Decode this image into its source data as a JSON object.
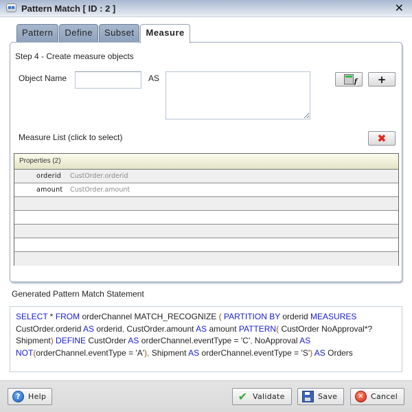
{
  "window": {
    "title": "Pattern Match [ ID : 2 ]",
    "close_glyph": "✕"
  },
  "tabs": [
    {
      "label": "Pattern",
      "active": false
    },
    {
      "label": "Define",
      "active": false
    },
    {
      "label": "Subset",
      "active": false
    },
    {
      "label": "Measure",
      "active": true
    }
  ],
  "measure": {
    "step_title": "Step 4 - Create measure objects",
    "object_name_label": "Object Name",
    "object_name_value": "",
    "as_label": "AS",
    "as_value": "",
    "expression_builder_icon": "calculator-fx-icon",
    "add_glyph": "+",
    "delete_glyph": "✖",
    "measure_list_label": "Measure List (click to select)",
    "table": {
      "header": "Properties (2)",
      "rows": [
        {
          "name": "orderid",
          "expression": "CustOrder.orderid"
        },
        {
          "name": "amount",
          "expression": "CustOrder.amount"
        }
      ]
    }
  },
  "statement": {
    "label": "Generated Pattern Match Statement",
    "tokens": [
      {
        "t": "SELECT",
        "k": "kw"
      },
      {
        "t": " * "
      },
      {
        "t": "FROM",
        "k": "kw"
      },
      {
        "t": " orderChannel  MATCH_RECOGNIZE "
      },
      {
        "t": "( ",
        "k": "pn"
      },
      {
        "t": "PARTITION BY",
        "k": "kw"
      },
      {
        "t": " orderid "
      },
      {
        "t": "MEASURES",
        "k": "kw"
      },
      {
        "t": " CustOrder.orderid "
      },
      {
        "t": "AS",
        "k": "kw"
      },
      {
        "t": " orderid"
      },
      {
        "t": ",",
        "k": "pn"
      },
      {
        "t": " CustOrder.amount "
      },
      {
        "t": "AS",
        "k": "kw"
      },
      {
        "t": " amount "
      },
      {
        "t": "PATTERN",
        "k": "kw"
      },
      {
        "t": "(",
        "k": "pn"
      },
      {
        "t": " CustOrder NoApproval*? Shipment"
      },
      {
        "t": ")",
        "k": "pn"
      },
      {
        "t": " "
      },
      {
        "t": "DEFINE",
        "k": "kw"
      },
      {
        "t": " CustOrder "
      },
      {
        "t": "AS",
        "k": "kw"
      },
      {
        "t": " orderChannel.eventType = 'C'"
      },
      {
        "t": ",",
        "k": "pn"
      },
      {
        "t": " NoApproval "
      },
      {
        "t": "AS",
        "k": "kw"
      },
      {
        "t": " "
      },
      {
        "t": "NOT",
        "k": "kw"
      },
      {
        "t": "(",
        "k": "pn"
      },
      {
        "t": "orderChannel.eventType = 'A'"
      },
      {
        "t": ")",
        "k": "pn"
      },
      {
        "t": ",",
        "k": "pn"
      },
      {
        "t": " Shipment "
      },
      {
        "t": "AS",
        "k": "kw"
      },
      {
        "t": " orderChannel.eventType = 'S'"
      },
      {
        "t": ")",
        "k": "pn"
      },
      {
        "t": " "
      },
      {
        "t": "AS",
        "k": "kw"
      },
      {
        "t": " Orders"
      }
    ]
  },
  "footer": {
    "help": "Help",
    "validate": "Validate",
    "save": "Save",
    "cancel": "Cancel"
  },
  "colors": {
    "keyword": "#1a1ad6",
    "punctuation": "#8a5a1c",
    "delete_icon": "#e3261b"
  }
}
